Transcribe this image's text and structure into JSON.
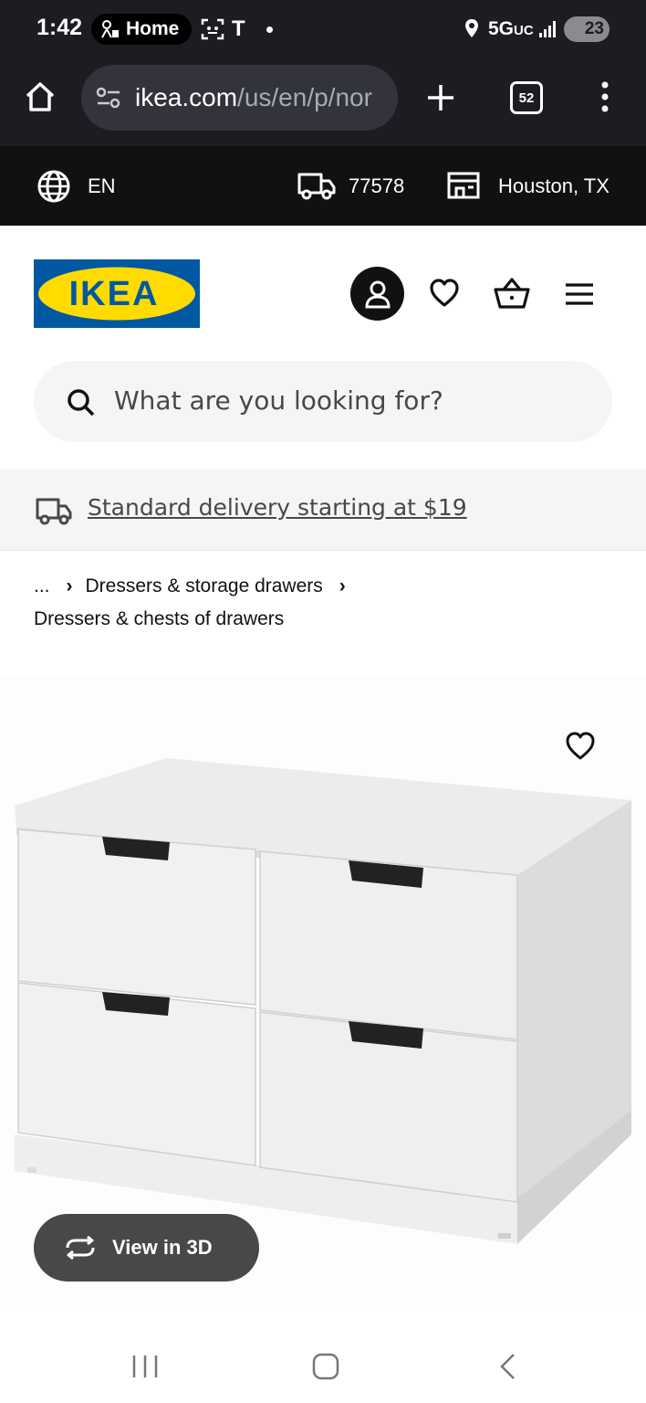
{
  "status_bar": {
    "time": "1:42",
    "home_label": "Home",
    "carrier_t": "T",
    "network": "5G",
    "network_suffix": "UC",
    "battery": "23"
  },
  "browser": {
    "url_host": "ikea.com",
    "url_path": "/us/en/p/nor",
    "tab_count": "52"
  },
  "locale": {
    "language": "EN",
    "zip": "77578",
    "store": "Houston, TX"
  },
  "header": {
    "logo_text": "IKEA",
    "search_placeholder": "What are you looking for?"
  },
  "delivery": {
    "text": "Standard delivery starting at $19"
  },
  "breadcrumb": {
    "ellipsis": "...",
    "level1": "Dressers & storage drawers",
    "level2": "Dressers & chests of drawers",
    "separator": "›"
  },
  "product": {
    "view3d_label": "View in 3D"
  },
  "colors": {
    "ikea_blue": "#0058a3",
    "ikea_yellow": "#ffdb00",
    "dark": "#111111"
  }
}
